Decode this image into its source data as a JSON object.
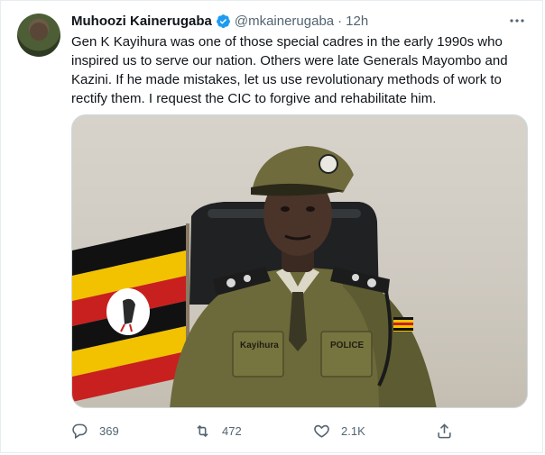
{
  "tweet": {
    "author_name": "Muhoozi Kainerugaba",
    "handle": "@mkainerugaba",
    "separator": "·",
    "time": "12h",
    "text": "Gen K Kayihura was one of those special cadres in the early 1990s who inspired us to serve our nation. Others were late Generals Mayombo and Kazini. If he made mistakes, let us use revolutionary methods of work to rectify them. I request the CIC to forgive and rehabilitate him."
  },
  "media": {
    "name_tag": "Kayihura",
    "police_tag": "POLICE"
  },
  "actions": {
    "reply_count": "369",
    "retweet_count": "472",
    "like_count": "2.1K"
  },
  "icons": {
    "verified": "verified-badge-icon",
    "more": "more-icon",
    "reply": "reply-icon",
    "retweet": "retweet-icon",
    "like": "heart-icon",
    "share": "share-icon"
  },
  "colors": {
    "verified": "#1d9bf0",
    "secondary_text": "#536471",
    "primary_text": "#0f1419"
  }
}
